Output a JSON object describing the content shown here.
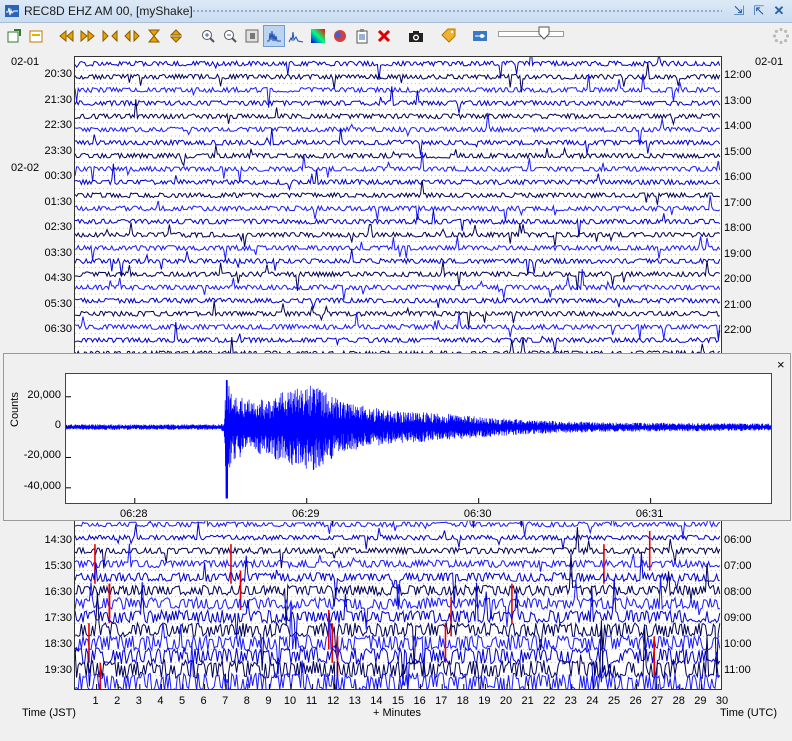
{
  "window": {
    "title": "REC8D EHZ AM 00, [myShake]"
  },
  "toolbar": {
    "buttons": [
      "new-icon",
      "open-icon",
      "rewind-icon",
      "fast-forward-icon",
      "zoom-range-icon",
      "pan-icon",
      "filter-icon",
      "fit-icon",
      "zoom-in-icon",
      "zoom-out-icon",
      "helicorder-icon",
      "spectrum-icon",
      "spectrogram-icon",
      "color-icon",
      "clipboard-icon",
      "clear-icon",
      "camera-icon",
      "tag-icon",
      "settings-icon"
    ]
  },
  "helicorder": {
    "left_dates": [
      {
        "label": "02-01",
        "row": 0
      },
      {
        "label": "02-02",
        "row": 4
      }
    ],
    "right_dates": [
      {
        "label": "02-01",
        "row": 0
      }
    ],
    "left_times_top": [
      "20:30",
      "21:30",
      "22:30",
      "23:30",
      "00:30",
      "01:30",
      "02:30",
      "03:30",
      "04:30",
      "05:30",
      "06:30"
    ],
    "right_times_top": [
      "12:00",
      "13:00",
      "14:00",
      "15:00",
      "16:00",
      "17:00",
      "18:00",
      "19:00",
      "20:00",
      "21:00",
      "22:00"
    ],
    "left_times_bottom": [
      "14:30",
      "15:30",
      "16:30",
      "17:30",
      "18:30",
      "19:30"
    ],
    "right_times_bottom": [
      "06:00",
      "07:00",
      "08:00",
      "09:00",
      "10:00",
      "11:00"
    ],
    "x_ticks": [
      "1",
      "2",
      "3",
      "4",
      "5",
      "6",
      "7",
      "8",
      "9",
      "10",
      "11",
      "12",
      "13",
      "14",
      "15",
      "16",
      "17",
      "18",
      "19",
      "20",
      "21",
      "22",
      "23",
      "24",
      "25",
      "26",
      "27",
      "28",
      "29",
      "30"
    ],
    "x_label": "+ Minutes",
    "left_axis_label": "Time (JST)",
    "right_axis_label": "Time (UTC)",
    "trace_colors": [
      "#0000cc",
      "#000055",
      "#1a1aff"
    ],
    "highlight_color": "#e60000"
  },
  "popup": {
    "close_label": "×",
    "chart_data": {
      "type": "line",
      "ylabel": "Counts",
      "y_ticks": [
        "20,000",
        "0",
        "-20,000",
        "-40,000"
      ],
      "y_tick_values": [
        20000,
        0,
        -20000,
        -40000
      ],
      "ylim": [
        -50000,
        35000
      ],
      "x_ticks": [
        "06:28",
        "06:29",
        "06:30",
        "06:31"
      ],
      "x_tick_minutes": [
        0.4,
        1.4,
        2.4,
        3.4
      ],
      "xlim_minutes": [
        0,
        4.1
      ],
      "series": [
        {
          "color": "#0000ff",
          "envelope": [
            {
              "t": 0.0,
              "amp": 1500
            },
            {
              "t": 0.9,
              "amp": 1500
            },
            {
              "t": 0.92,
              "amp": 3000
            },
            {
              "t": 0.93,
              "amp": 30000
            },
            {
              "t": 0.97,
              "amp": 18000
            },
            {
              "t": 1.1,
              "amp": 14000
            },
            {
              "t": 1.35,
              "amp": 22000
            },
            {
              "t": 1.45,
              "amp": 24000
            },
            {
              "t": 1.6,
              "amp": 14000
            },
            {
              "t": 1.9,
              "amp": 9000
            },
            {
              "t": 2.2,
              "amp": 7500
            },
            {
              "t": 2.5,
              "amp": 5000
            },
            {
              "t": 2.8,
              "amp": 3500
            },
            {
              "t": 3.2,
              "amp": 2500
            },
            {
              "t": 4.1,
              "amp": 2000
            }
          ],
          "min_value": -47000,
          "max_value": 31000
        }
      ]
    }
  }
}
